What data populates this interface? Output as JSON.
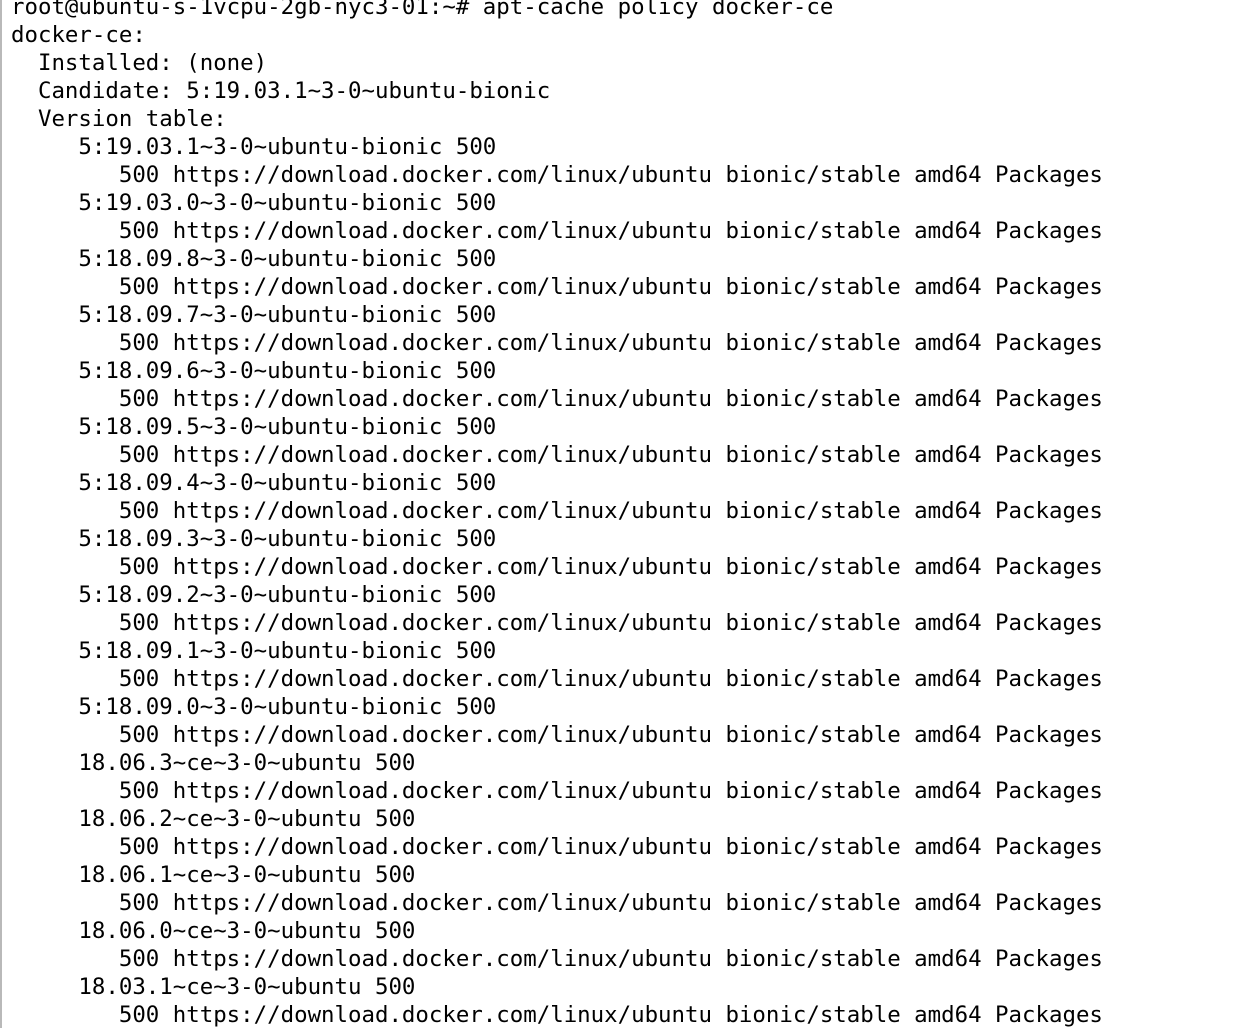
{
  "terminal": {
    "prompt": "root@ubuntu-s-1vcpu-2gb-nyc3-01:~# apt-cache policy docker-ce",
    "package": "docker-ce:",
    "installed": "  Installed: (none)",
    "candidate": "  Candidate: 5:19.03.1~3-0~ubuntu-bionic",
    "version_table": "  Version table:",
    "entries": [
      {
        "version": "     5:19.03.1~3-0~ubuntu-bionic 500",
        "source": "        500 https://download.docker.com/linux/ubuntu bionic/stable amd64 Packages"
      },
      {
        "version": "     5:19.03.0~3-0~ubuntu-bionic 500",
        "source": "        500 https://download.docker.com/linux/ubuntu bionic/stable amd64 Packages"
      },
      {
        "version": "     5:18.09.8~3-0~ubuntu-bionic 500",
        "source": "        500 https://download.docker.com/linux/ubuntu bionic/stable amd64 Packages"
      },
      {
        "version": "     5:18.09.7~3-0~ubuntu-bionic 500",
        "source": "        500 https://download.docker.com/linux/ubuntu bionic/stable amd64 Packages"
      },
      {
        "version": "     5:18.09.6~3-0~ubuntu-bionic 500",
        "source": "        500 https://download.docker.com/linux/ubuntu bionic/stable amd64 Packages"
      },
      {
        "version": "     5:18.09.5~3-0~ubuntu-bionic 500",
        "source": "        500 https://download.docker.com/linux/ubuntu bionic/stable amd64 Packages"
      },
      {
        "version": "     5:18.09.4~3-0~ubuntu-bionic 500",
        "source": "        500 https://download.docker.com/linux/ubuntu bionic/stable amd64 Packages"
      },
      {
        "version": "     5:18.09.3~3-0~ubuntu-bionic 500",
        "source": "        500 https://download.docker.com/linux/ubuntu bionic/stable amd64 Packages"
      },
      {
        "version": "     5:18.09.2~3-0~ubuntu-bionic 500",
        "source": "        500 https://download.docker.com/linux/ubuntu bionic/stable amd64 Packages"
      },
      {
        "version": "     5:18.09.1~3-0~ubuntu-bionic 500",
        "source": "        500 https://download.docker.com/linux/ubuntu bionic/stable amd64 Packages"
      },
      {
        "version": "     5:18.09.0~3-0~ubuntu-bionic 500",
        "source": "        500 https://download.docker.com/linux/ubuntu bionic/stable amd64 Packages"
      },
      {
        "version": "     18.06.3~ce~3-0~ubuntu 500",
        "source": "        500 https://download.docker.com/linux/ubuntu bionic/stable amd64 Packages"
      },
      {
        "version": "     18.06.2~ce~3-0~ubuntu 500",
        "source": "        500 https://download.docker.com/linux/ubuntu bionic/stable amd64 Packages"
      },
      {
        "version": "     18.06.1~ce~3-0~ubuntu 500",
        "source": "        500 https://download.docker.com/linux/ubuntu bionic/stable amd64 Packages"
      },
      {
        "version": "     18.06.0~ce~3-0~ubuntu 500",
        "source": "        500 https://download.docker.com/linux/ubuntu bionic/stable amd64 Packages"
      },
      {
        "version": "     18.03.1~ce~3-0~ubuntu 500",
        "source": "        500 https://download.docker.com/linux/ubuntu bionic/stable amd64 Packages"
      }
    ]
  },
  "colors": {
    "background": "#ffffff",
    "foreground": "#000000"
  }
}
